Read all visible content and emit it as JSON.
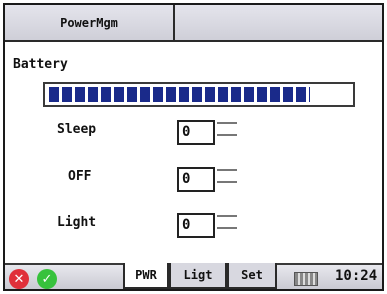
{
  "window": {
    "title": "PowerMgm"
  },
  "battery": {
    "label": "Battery",
    "level": 0.87
  },
  "settings": {
    "sleep": {
      "label": "Sleep",
      "value": "0"
    },
    "off": {
      "label": "OFF",
      "value": "0"
    },
    "light": {
      "label": "Light",
      "value": "0"
    }
  },
  "taskbar": {
    "tabs": [
      {
        "label": "PWR",
        "active": true
      },
      {
        "label": "Ligt",
        "active": false
      },
      {
        "label": "Set",
        "active": false
      }
    ],
    "cancel_icon": "x-circle-icon",
    "ok_icon": "check-circle-icon",
    "keyboard_icon": "keyboard-icon",
    "time": "10:24",
    "cancel_color": "#e0303a",
    "ok_color": "#37c23c"
  }
}
